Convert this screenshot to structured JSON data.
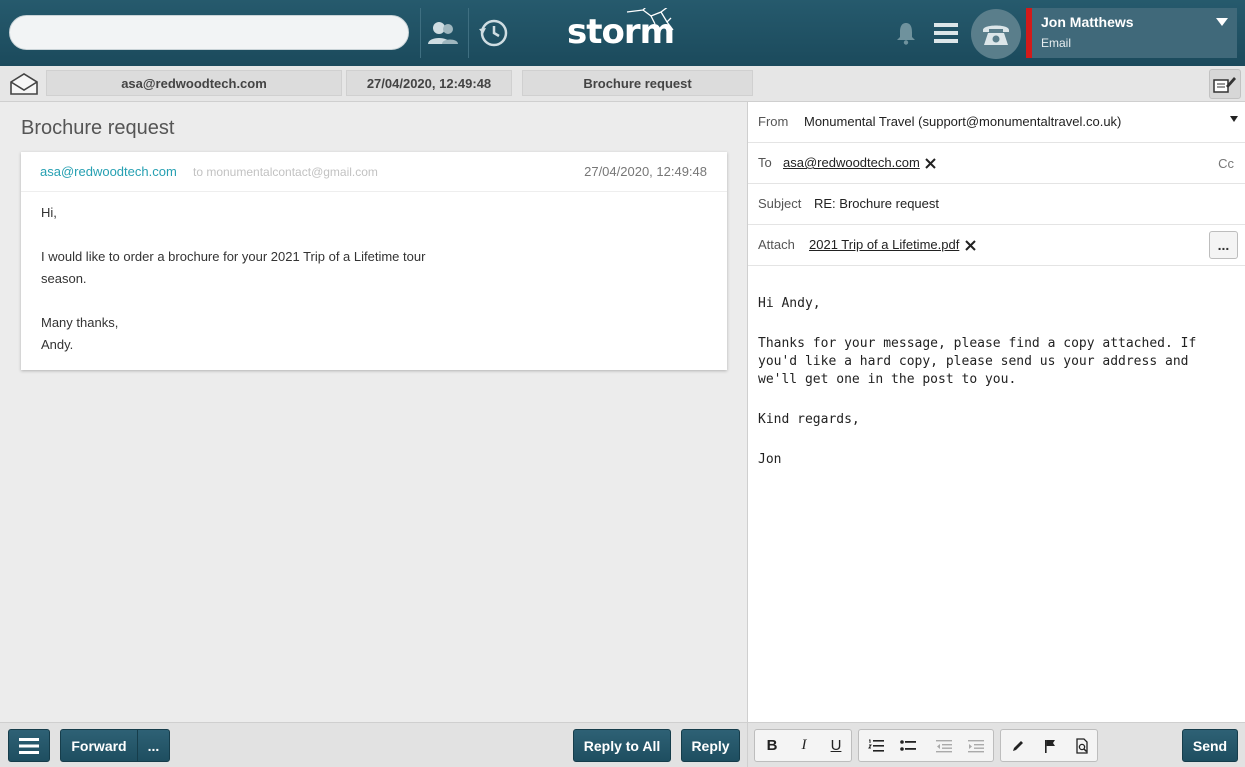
{
  "topbar": {
    "search_value": "",
    "logo_text": "storm",
    "user": {
      "name": "Jon Matthews",
      "channel": "Email"
    }
  },
  "info": {
    "from": "asa@redwoodtech.com",
    "datetime": "27/04/2020, 12:49:48",
    "subject": "Brochure request"
  },
  "message": {
    "title": "Brochure request",
    "from": "asa@redwoodtech.com",
    "to": "to monumentalcontact@gmail.com",
    "date": "27/04/2020, 12:49:48",
    "body": {
      "greeting": "Hi,",
      "line1": "I would like to order a brochure for your 2021 Trip of a Lifetime tour",
      "line2": "season.",
      "closing1": "Many thanks,",
      "closing2": "Andy."
    }
  },
  "compose": {
    "from_label": "From",
    "from_value": "Monumental Travel (support@monumentaltravel.co.uk)",
    "to_label": "To",
    "to_value": "asa@redwoodtech.com",
    "cc_label": "Cc",
    "subject_label": "Subject",
    "subject_value": "RE: Brochure request",
    "attach_label": "Attach",
    "attach_value": "2021 Trip of a Lifetime.pdf",
    "more_label": "...",
    "body": {
      "p1": "Hi Andy,",
      "p2": "Thanks for your message, please find a copy attached. If you'd like a hard copy, please send us your address and we'll get one in the post to you.",
      "p3": "Kind regards,",
      "p4": "Jon"
    }
  },
  "bottom_left": {
    "forward": "Forward",
    "more": "...",
    "reply_all": "Reply to All",
    "reply": "Reply"
  },
  "bottom_right": {
    "bold": "B",
    "italic": "I",
    "underline": "U",
    "send": "Send"
  },
  "icons": [
    "contacts-icon",
    "history-icon",
    "bell-icon",
    "menu-icon",
    "phone-icon",
    "envelope-open-icon",
    "popout-icon",
    "close-icon",
    "numbered-list-icon",
    "bullet-list-icon",
    "outdent-icon",
    "indent-icon",
    "pen-icon",
    "flag-icon",
    "spellcheck-icon"
  ],
  "colors": {
    "topbar": "#1f4f61",
    "accent_link": "#26a0b2",
    "status_red": "#d21a1a",
    "button_dark": "#265a6d"
  }
}
